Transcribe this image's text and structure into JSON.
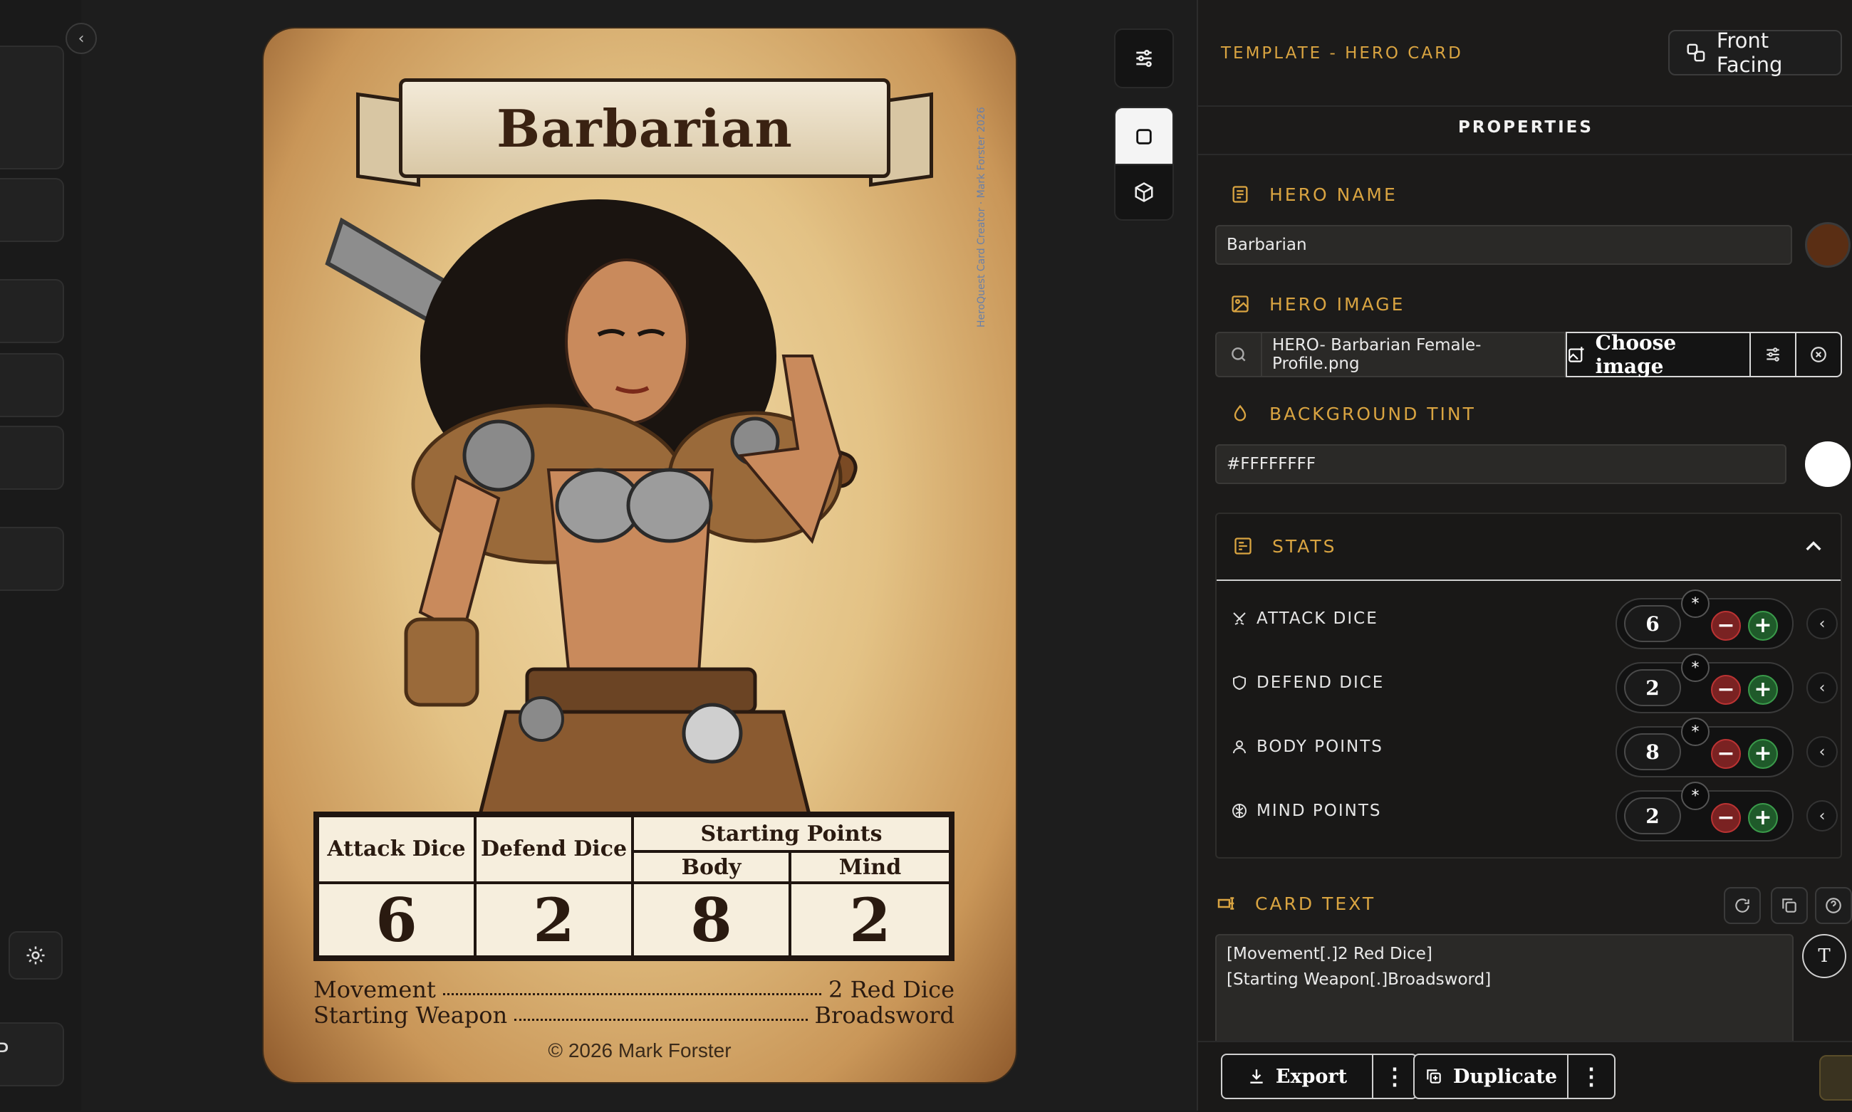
{
  "card": {
    "title": "Barbarian",
    "stats_header": {
      "attack": "Attack Dice",
      "defend": "Defend Dice",
      "starting_points": "Starting Points",
      "body": "Body",
      "mind": "Mind"
    },
    "stats_values": {
      "attack": "6",
      "defend": "2",
      "body": "8",
      "mind": "2"
    },
    "lines": [
      {
        "label": "Movement",
        "value": "2 Red Dice"
      },
      {
        "label": "Starting Weapon",
        "value": "Broadsword"
      }
    ],
    "copyright": "© 2026 Mark Forster",
    "side_credit": "HeroQuest Card Creator · Mark Forster 2026"
  },
  "panel": {
    "template_label": "TEMPLATE - HERO CARD",
    "front_facing_label": "Front Facing",
    "properties_title": "PROPERTIES",
    "hero_name": {
      "label": "HERO NAME",
      "value": "Barbarian",
      "swatch_color": "#5a2e14"
    },
    "hero_image": {
      "label": "HERO IMAGE",
      "file": "HERO- Barbarian Female- Profile.png",
      "choose_label": "Choose image"
    },
    "background_tint": {
      "label": "BACKGROUND TINT",
      "value": "#FFFFFFFF",
      "swatch_color": "#ffffff"
    },
    "stats": {
      "label": "STATS",
      "rows": [
        {
          "label": "ATTACK DICE",
          "value": "6",
          "icon": "crossed-swords-icon"
        },
        {
          "label": "DEFEND DICE",
          "value": "2",
          "icon": "shield-icon"
        },
        {
          "label": "BODY POINTS",
          "value": "8",
          "icon": "person-icon"
        },
        {
          "label": "MIND POINTS",
          "value": "2",
          "icon": "brain-icon"
        }
      ],
      "star": "*",
      "minus": "−",
      "plus": "+"
    },
    "card_text": {
      "label": "CARD TEXT",
      "lines": [
        "[Movement[.]2 Red Dice]",
        "[Starting Weapon[.]Broadsword]"
      ],
      "t_button": "T"
    },
    "bottom": {
      "export_label": "Export",
      "duplicate_label": "Duplicate",
      "more": "⋮"
    }
  },
  "left_rail": {
    "collapse_glyph": "‹",
    "partial_label": "P"
  },
  "colors": {
    "accent_gold": "#d9a441",
    "minus_red": "#7a2222",
    "plus_green": "#1f5a2a"
  }
}
